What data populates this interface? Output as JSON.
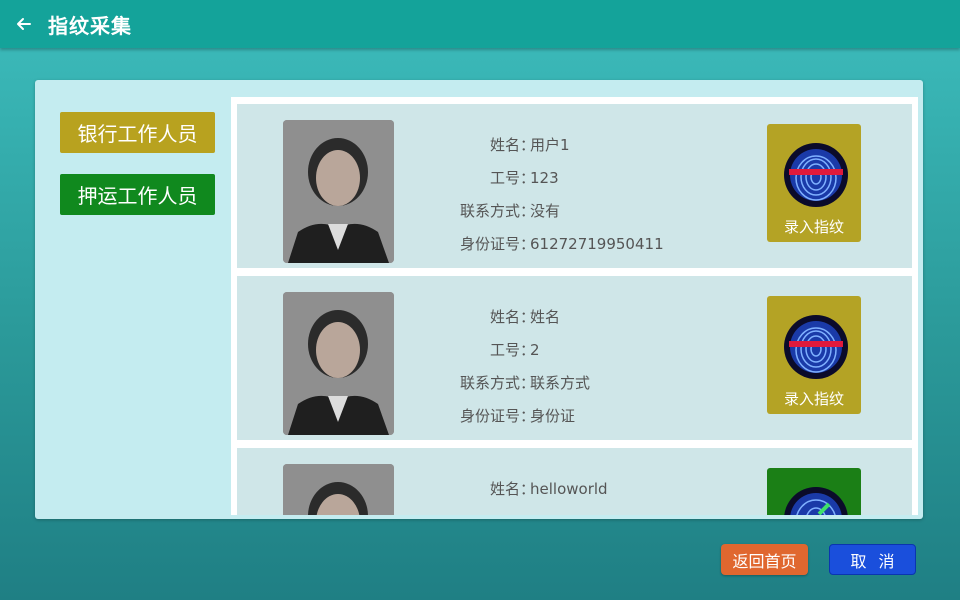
{
  "header": {
    "title": "指纹采集",
    "back_icon": "arrow-left-icon"
  },
  "categories": [
    {
      "label": "银行工作人员",
      "color": "#b8a21f"
    },
    {
      "label": "押运工作人员",
      "color": "#10891e"
    }
  ],
  "field_labels": {
    "name": "姓名",
    "id": "工号",
    "contact": "联系方式",
    "idcard": "身份证号"
  },
  "separator": "：",
  "users": [
    {
      "name": "用户1",
      "id": "123",
      "contact": "没有",
      "idcard": "61272719950411",
      "button_label": "录入指纹",
      "button_color": "#b4a325"
    },
    {
      "name": "姓名",
      "id": "2",
      "contact": "联系方式",
      "idcard": "身份证",
      "button_label": "录入指纹",
      "button_color": "#b4a325"
    },
    {
      "name": "helloworld",
      "id": "",
      "contact": "",
      "idcard": "",
      "button_label": "",
      "button_color": "#1b7f16"
    }
  ],
  "footer": {
    "home_label": "返回首页",
    "cancel_label": "取消"
  }
}
